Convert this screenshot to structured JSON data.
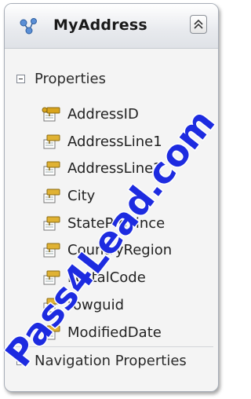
{
  "entity": {
    "name": "MyAddress",
    "icon": "entity-type-icon",
    "collapse_icon": "double-chevron-up-icon"
  },
  "sections": {
    "properties": {
      "label": "Properties",
      "expanded": true
    },
    "navigation": {
      "label": "Navigation Properties",
      "expanded": true
    }
  },
  "properties": [
    {
      "name": "AddressID",
      "key": true
    },
    {
      "name": "AddressLine1",
      "key": false
    },
    {
      "name": "AddressLine2",
      "key": false
    },
    {
      "name": "City",
      "key": false
    },
    {
      "name": "StateProvince",
      "key": false
    },
    {
      "name": "CountryRegion",
      "key": false
    },
    {
      "name": "PostalCode",
      "key": false
    },
    {
      "name": "rowguid",
      "key": false
    },
    {
      "name": "ModifiedDate",
      "key": false
    }
  ],
  "watermark": {
    "text": "Pass4Lead.com",
    "color": "#1d2be0"
  },
  "colors": {
    "property_icon": "#e0b233",
    "key_icon": "#d9a41c"
  }
}
